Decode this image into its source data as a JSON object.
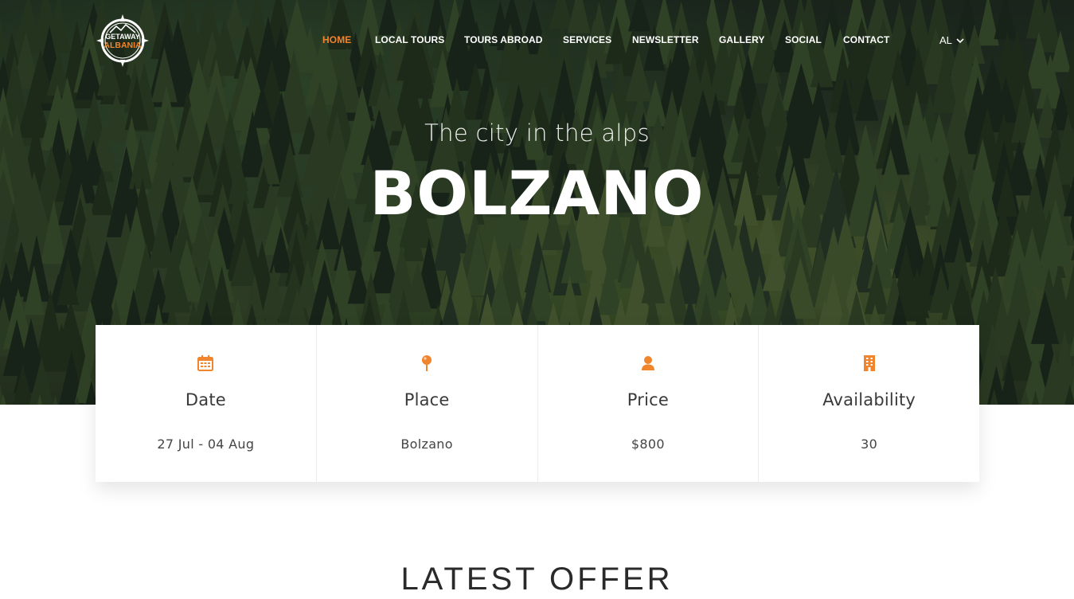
{
  "brand": {
    "logo_line1": "GETAWAY",
    "logo_line2": "ALBANIA",
    "accent_color": "#f0852d"
  },
  "nav": {
    "items": [
      {
        "label": "HOME",
        "active": true
      },
      {
        "label": "LOCAL TOURS",
        "active": false
      },
      {
        "label": "TOURS ABROAD",
        "active": false
      },
      {
        "label": "SERVICES",
        "active": false
      },
      {
        "label": "NEWSLETTER",
        "active": false
      },
      {
        "label": "GALLERY",
        "active": false
      },
      {
        "label": "SOCIAL",
        "active": false
      },
      {
        "label": "CONTACT",
        "active": false
      }
    ],
    "language": "AL"
  },
  "hero": {
    "subtitle": "The city in the alps",
    "title": "BOLZANO",
    "background": "pine-forest-aerial-photo"
  },
  "info": [
    {
      "icon": "calendar-icon",
      "label": "Date",
      "value": "27 Jul - 04 Aug"
    },
    {
      "icon": "map-pin-icon",
      "label": "Place",
      "value": "Bolzano"
    },
    {
      "icon": "user-icon",
      "label": "Price",
      "value": "$800"
    },
    {
      "icon": "building-icon",
      "label": "Availability",
      "value": "30"
    }
  ],
  "section": {
    "title": "LATEST OFFER"
  }
}
